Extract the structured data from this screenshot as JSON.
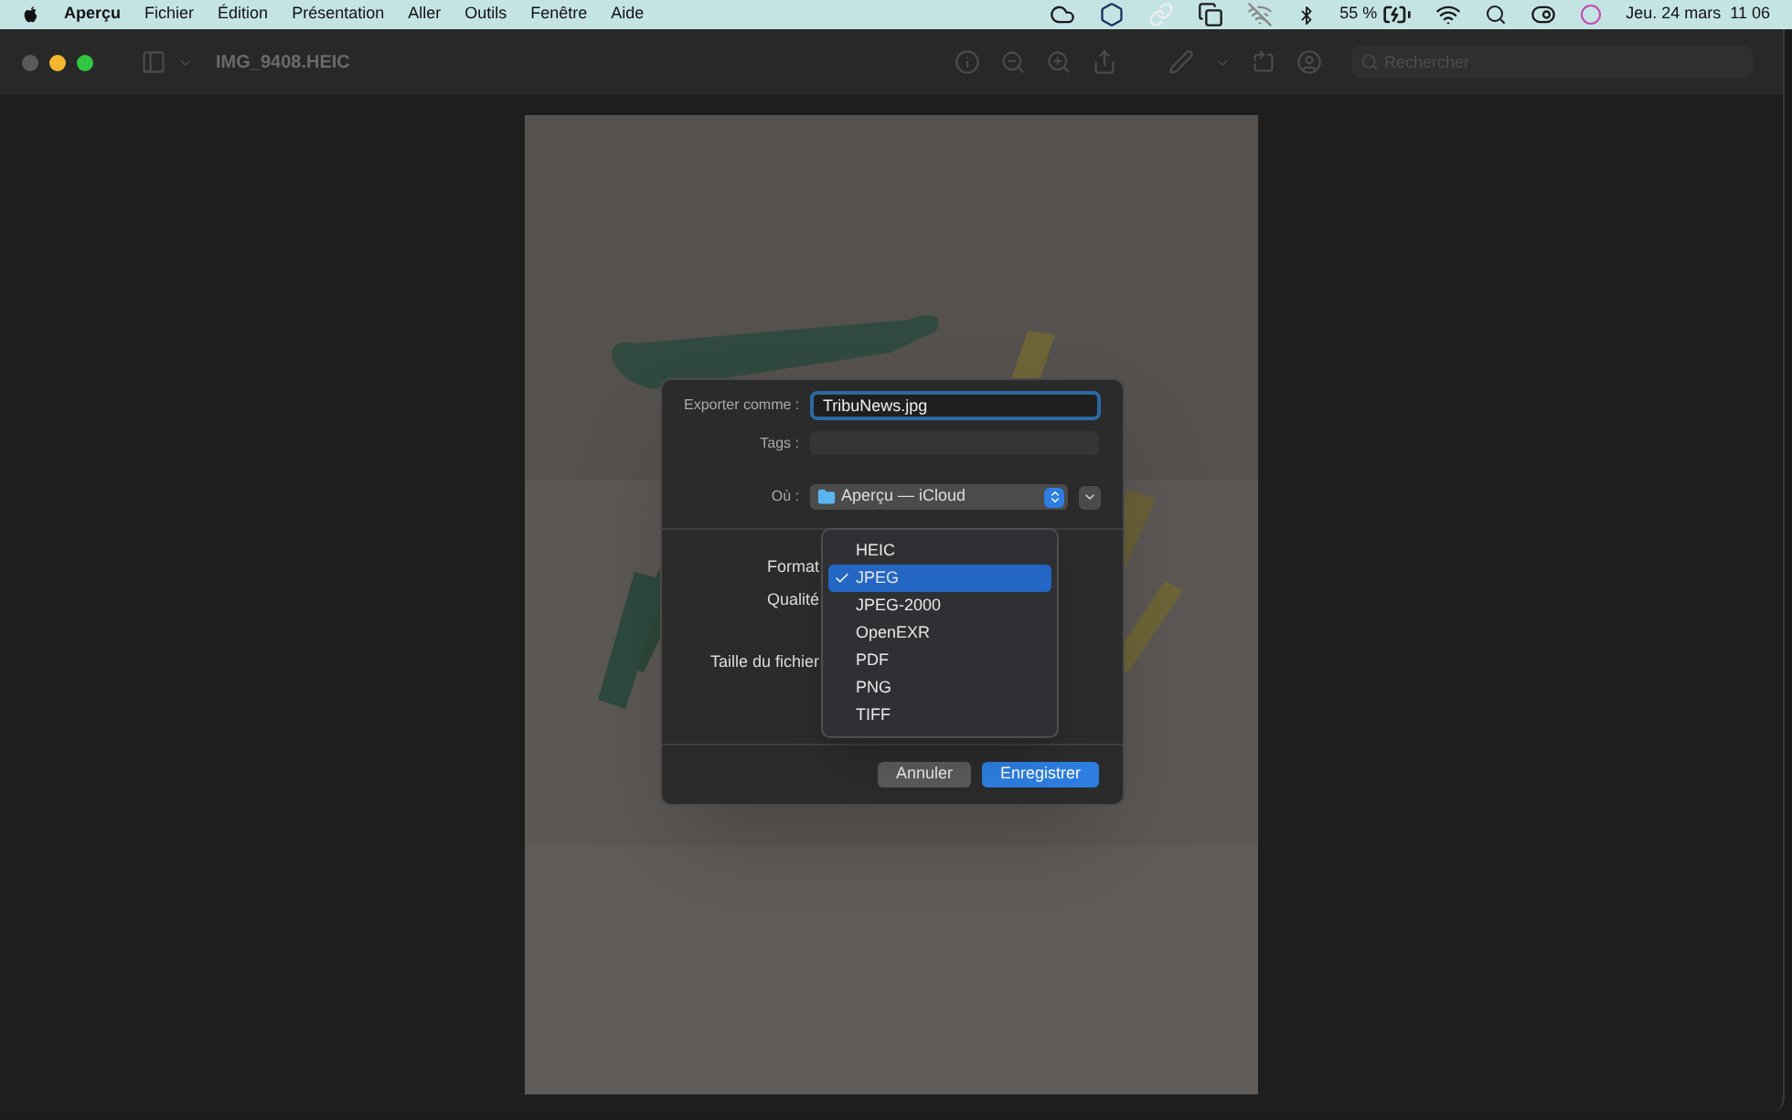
{
  "menu_bar": {
    "app": "Aperçu",
    "menus": [
      "Fichier",
      "Édition",
      "Présentation",
      "Aller",
      "Outils",
      "Fenêtre",
      "Aide"
    ],
    "battery": "55 %",
    "clock": "Jeu. 24 mars  11 06"
  },
  "window": {
    "title": "IMG_9408.HEIC",
    "search": {
      "placeholder": "Rechercher"
    }
  },
  "export_dialog": {
    "export_as": {
      "label": "Exporter comme :",
      "value": "TribuNews.jpg"
    },
    "tags": {
      "label": "Tags :"
    },
    "location": {
      "label": "Où :",
      "value": "Aperçu — iCloud"
    },
    "option_labels": [
      "Format",
      "Qualité",
      "Taille du fichier"
    ],
    "format_menu": [
      {
        "label": "HEIC",
        "selected": false
      },
      {
        "label": "JPEG",
        "selected": true
      },
      {
        "label": "JPEG-2000",
        "selected": false
      },
      {
        "label": "OpenEXR",
        "selected": false
      },
      {
        "label": "PDF",
        "selected": false
      },
      {
        "label": "PNG",
        "selected": false
      },
      {
        "label": "TIFF",
        "selected": false
      }
    ],
    "buttons": [
      {
        "label": "Annuler",
        "kind": "cancel"
      },
      {
        "label": "Enregistrer",
        "kind": "default"
      }
    ]
  }
}
